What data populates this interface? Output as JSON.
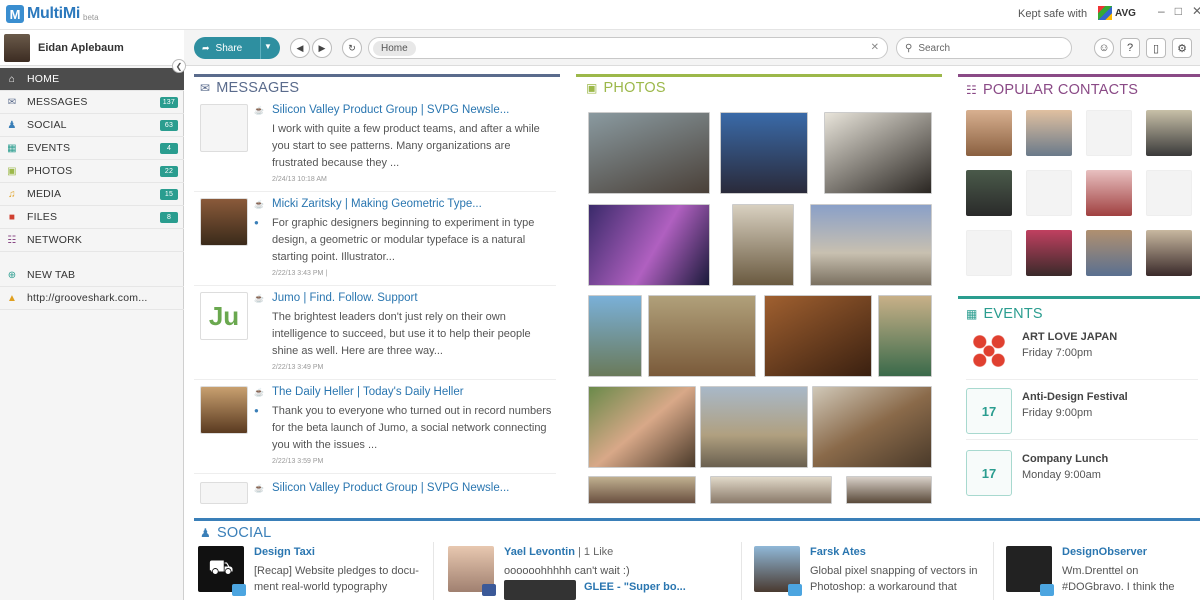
{
  "app": {
    "name": "MultiMi",
    "badge": "beta",
    "kept_safe": "Kept safe with",
    "av_brand": "AVG"
  },
  "user": {
    "name": "Eidan Aplebaum"
  },
  "sidebar": {
    "items": [
      {
        "label": "HOME",
        "icon": "home-icon",
        "count": "",
        "active": true
      },
      {
        "label": "MESSAGES",
        "icon": "envelope-icon",
        "count": "137"
      },
      {
        "label": "SOCIAL",
        "icon": "people-icon",
        "count": "63"
      },
      {
        "label": "EVENTS",
        "icon": "calendar-icon",
        "count": "4"
      },
      {
        "label": "PHOTOS",
        "icon": "camera-icon",
        "count": "22"
      },
      {
        "label": "MEDIA",
        "icon": "headphones-icon",
        "count": "15"
      },
      {
        "label": "FILES",
        "icon": "file-icon",
        "count": "8"
      },
      {
        "label": "NETWORK",
        "icon": "network-icon",
        "count": ""
      }
    ],
    "new_tab": "NEW TAB",
    "bookmark": "http://grooveshark.com..."
  },
  "toolbar": {
    "share": "Share",
    "address": "Home",
    "search_placeholder": "Search"
  },
  "messages": {
    "title": "MESSAGES",
    "items": [
      {
        "title": "Silicon Valley Product Group | SVPG Newsle...",
        "body": "I work with quite a few product teams, and after a while you start to see patterns.  Many organizations are frustrated because they ...",
        "time": "2/24/13 10:18 AM"
      },
      {
        "title": "Micki Zaritsky | Making Geometric Type...",
        "body": "For graphic designers beginning to experiment in type design, a geometric or modular typeface is a natural starting point. Illustrator...",
        "time": "2/22/13 3:43 PM  |"
      },
      {
        "title": "Jumo | Find. Follow. Support",
        "body": "The brightest leaders don't just rely on their own intelligence to succeed, but use it to help their people shine as well. Here are three way...",
        "time": "2/22/13 3:49 PM"
      },
      {
        "title": "The Daily Heller | Today's Daily Heller",
        "body": "Thank you to everyone who turned out in record numbers for the beta launch of Jumo, a social network connecting you with the issues ...",
        "time": "2/22/13 3:59 PM"
      },
      {
        "title": "Silicon Valley Product Group | SVPG Newsle...",
        "body": "",
        "time": ""
      }
    ]
  },
  "photos": {
    "title": "PHOTOS"
  },
  "contacts": {
    "title": "POPULAR CONTACTS"
  },
  "events": {
    "title": "EVENTS",
    "items": [
      {
        "title": "ART LOVE JAPAN",
        "time": "Friday 7:00pm",
        "day": ""
      },
      {
        "title": "Anti-Design Festival",
        "time": "Friday 9:00pm",
        "day": "17"
      },
      {
        "title": "Company Lunch",
        "time": "Monday 9:00am",
        "day": "17"
      }
    ]
  },
  "social": {
    "title": "SOCIAL",
    "items": [
      {
        "name": "Design Taxi",
        "extra": "",
        "text": "[Recap] Website pledges to docu-ment real-world typography"
      },
      {
        "name": "Yael Levontin",
        "extra": "| 1 Like",
        "text": "oooooohhhhh can't wait :)",
        "sub": "GLEE - \"Super bo..."
      },
      {
        "name": "Farsk Ates",
        "extra": "",
        "text": "Global pixel snapping of vectors in Photoshop: a workaround that"
      },
      {
        "name": "DesignObserver",
        "extra": "",
        "text": "Wm.Drenttel on #DOGbravo. I think the"
      }
    ]
  },
  "colors": {
    "messages": "#5a6b8c",
    "photos": "#9cb84a",
    "contacts": "#8a4a86",
    "events": "#2a9d8f",
    "social": "#3a7fb8"
  }
}
